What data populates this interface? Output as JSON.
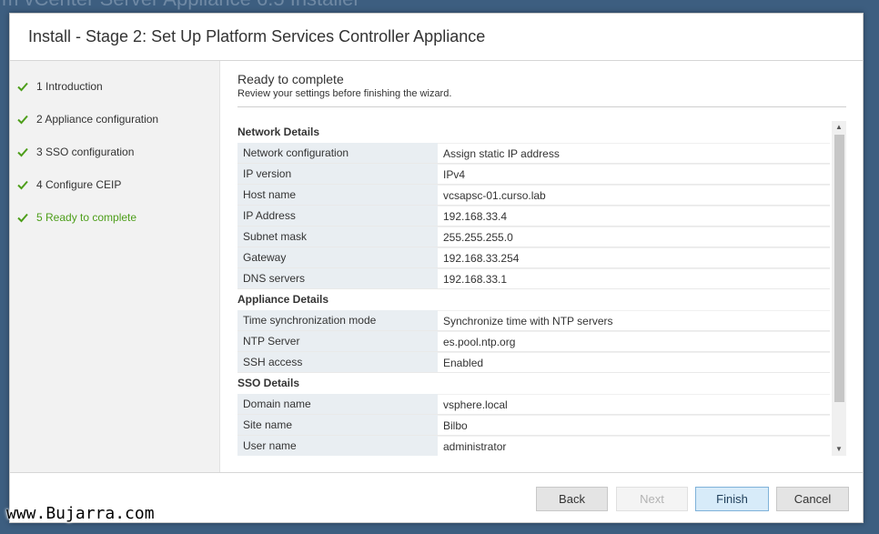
{
  "background_title": "m  vCenter Server Appliance 6.5 Installer",
  "dialog": {
    "title": "Install - Stage 2: Set Up Platform Services Controller Appliance"
  },
  "steps": [
    {
      "label": "1 Introduction",
      "completed": true,
      "active": false
    },
    {
      "label": "2 Appliance configuration",
      "completed": true,
      "active": false
    },
    {
      "label": "3 SSO configuration",
      "completed": true,
      "active": false
    },
    {
      "label": "4 Configure CEIP",
      "completed": true,
      "active": false
    },
    {
      "label": "5 Ready to complete",
      "completed": true,
      "active": true
    }
  ],
  "page": {
    "heading": "Ready to complete",
    "subheading": "Review your settings before finishing the wizard."
  },
  "network": {
    "title": "Network Details",
    "rows": [
      {
        "label": "Network configuration",
        "value": "Assign static IP address"
      },
      {
        "label": "IP version",
        "value": "IPv4"
      },
      {
        "label": "Host name",
        "value": "vcsapsc-01.curso.lab"
      },
      {
        "label": "IP Address",
        "value": "192.168.33.4"
      },
      {
        "label": "Subnet mask",
        "value": "255.255.255.0"
      },
      {
        "label": "Gateway",
        "value": "192.168.33.254"
      },
      {
        "label": "DNS servers",
        "value": "192.168.33.1"
      }
    ]
  },
  "appliance": {
    "title": "Appliance Details",
    "rows": [
      {
        "label": "Time synchronization mode",
        "value": "Synchronize time with NTP servers"
      },
      {
        "label": "NTP Server",
        "value": "es.pool.ntp.org"
      },
      {
        "label": "SSH access",
        "value": "Enabled"
      }
    ]
  },
  "sso": {
    "title": "SSO Details",
    "rows": [
      {
        "label": "Domain name",
        "value": "vsphere.local"
      },
      {
        "label": "Site name",
        "value": "Bilbo"
      },
      {
        "label": "User name",
        "value": "administrator"
      }
    ]
  },
  "buttons": {
    "back": "Back",
    "next": "Next",
    "finish": "Finish",
    "cancel": "Cancel"
  },
  "watermark": "www.Bujarra.com",
  "colors": {
    "accent_green": "#4d9e1a",
    "primary_button": "#d7ebf9",
    "desktop_background": "#3d5e80"
  },
  "icons": {
    "step_check": "check-icon",
    "scroll_up": "arrow-up-icon",
    "scroll_down": "arrow-down-icon"
  }
}
